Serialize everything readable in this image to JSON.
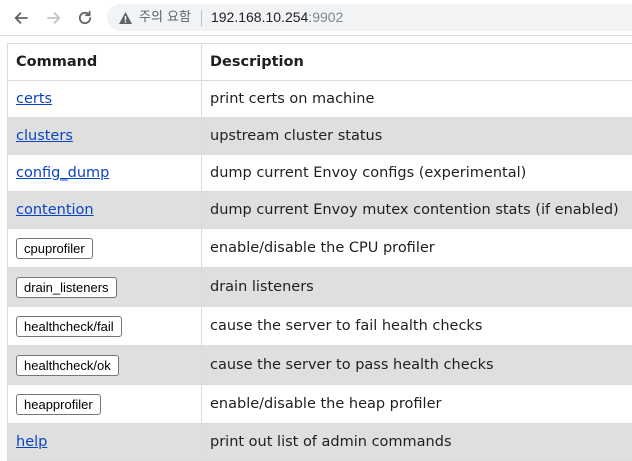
{
  "browser": {
    "security_label": "주의 요함",
    "url_host": "192.168.10.254",
    "url_port": ":9902"
  },
  "table": {
    "headers": {
      "command": "Command",
      "description": "Description"
    },
    "rows": [
      {
        "command": "certs",
        "kind": "link",
        "description": "print certs on machine"
      },
      {
        "command": "clusters",
        "kind": "link",
        "description": "upstream cluster status"
      },
      {
        "command": "config_dump",
        "kind": "link",
        "description": "dump current Envoy configs (experimental)"
      },
      {
        "command": "contention",
        "kind": "link",
        "description": "dump current Envoy mutex contention stats (if enabled)"
      },
      {
        "command": "cpuprofiler",
        "kind": "button",
        "description": "enable/disable the CPU profiler"
      },
      {
        "command": "drain_listeners",
        "kind": "button",
        "description": "drain listeners"
      },
      {
        "command": "healthcheck/fail",
        "kind": "button",
        "description": "cause the server to fail health checks"
      },
      {
        "command": "healthcheck/ok",
        "kind": "button",
        "description": "cause the server to pass health checks"
      },
      {
        "command": "heapprofiler",
        "kind": "button",
        "description": "enable/disable the heap profiler"
      },
      {
        "command": "help",
        "kind": "link",
        "description": "print out list of admin commands"
      }
    ]
  },
  "colors": {
    "link": "#0a44c4",
    "row_shade": "#dfdfdf",
    "border": "#dcdcdc"
  }
}
